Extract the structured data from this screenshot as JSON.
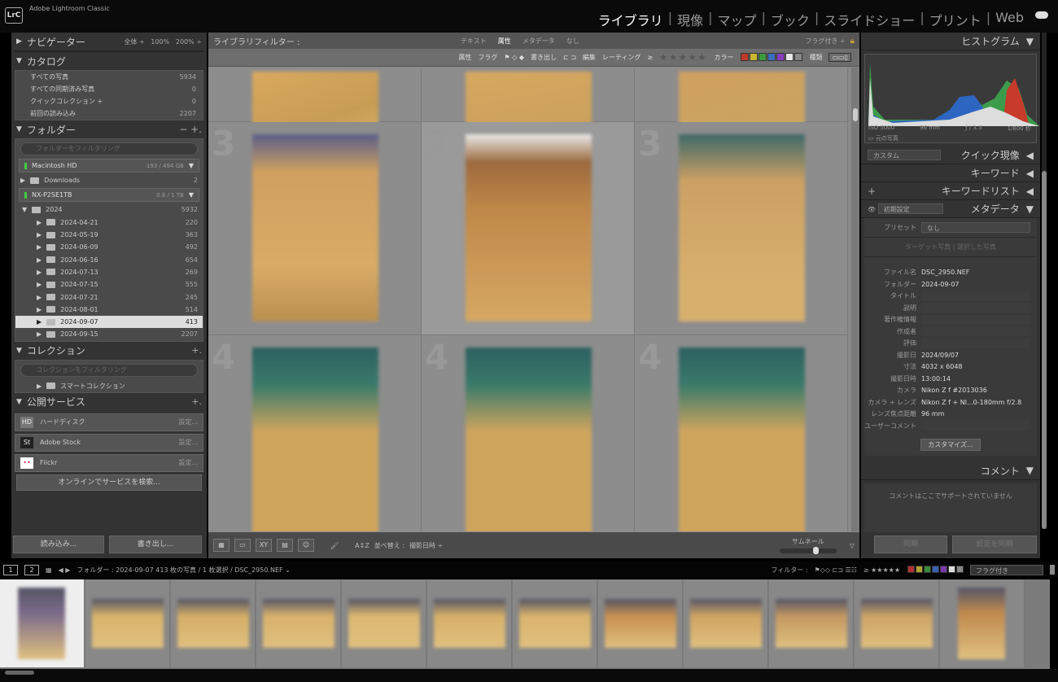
{
  "app": {
    "logo": "LrC",
    "title": "Adobe Lightroom Classic"
  },
  "modules": [
    "ライブラリ",
    "現像",
    "マップ",
    "ブック",
    "スライドショー",
    "プリント",
    "Web"
  ],
  "active_module": "ライブラリ",
  "navigator": {
    "title": "ナビゲーター",
    "options": [
      "全体",
      "100%",
      "200%"
    ]
  },
  "catalog": {
    "title": "カタログ",
    "items": [
      {
        "label": "すべての写真",
        "count": "5934"
      },
      {
        "label": "すべての同期済み写真",
        "count": "0"
      },
      {
        "label": "クイックコレクション +",
        "count": "0"
      },
      {
        "label": "前回の読み込み",
        "count": "2207"
      }
    ]
  },
  "folders": {
    "title": "フォルダー",
    "actions": "−  +.",
    "search_placeholder": "フォルダーをフィルタリング",
    "volume1": {
      "name": "Macintosh HD",
      "size": "193 / 494 GB"
    },
    "vol1_items": [
      {
        "label": "Downloads",
        "count": "2"
      }
    ],
    "volume2": {
      "name": "NX-P2SE1TB",
      "size": "0.8 / 1 TB"
    },
    "root": {
      "label": "2024",
      "count": "5932"
    },
    "items": [
      {
        "label": "2024-04-21",
        "count": "220"
      },
      {
        "label": "2024-05-19",
        "count": "363"
      },
      {
        "label": "2024-06-09",
        "count": "492"
      },
      {
        "label": "2024-06-16",
        "count": "654"
      },
      {
        "label": "2024-07-13",
        "count": "269"
      },
      {
        "label": "2024-07-15",
        "count": "555"
      },
      {
        "label": "2024-07-21",
        "count": "245"
      },
      {
        "label": "2024-08-01",
        "count": "514"
      },
      {
        "label": "2024-09-07",
        "count": "413"
      },
      {
        "label": "2024-09-15",
        "count": "2207"
      }
    ],
    "selected": "2024-09-07"
  },
  "collections": {
    "title": "コレクション",
    "search_placeholder": "コレクションをフィルタリング",
    "items": [
      {
        "label": "スマートコレクション"
      }
    ]
  },
  "publish": {
    "title": "公開サービス",
    "items": [
      {
        "label": "ハードディスク",
        "icon": "HD",
        "action": "設定..."
      },
      {
        "label": "Adobe Stock",
        "icon": "St",
        "action": "設定..."
      },
      {
        "label": "Flickr",
        "icon": "••",
        "action": "設定..."
      }
    ],
    "find": "オンラインでサービスを検索..."
  },
  "left_buttons": {
    "import": "読み込み...",
    "export": "書き出し..."
  },
  "filter": {
    "title": "ライブラリフィルター :",
    "tabs": [
      "テキスト",
      "属性",
      "メタデータ",
      "なし"
    ],
    "active_tab": "属性",
    "preset": "フラグ付き ÷",
    "attr_label": "属性",
    "flag_label": "フラグ",
    "export_label": "書き出し",
    "edit_label": "編集",
    "rating_label": "レーティング",
    "rating_op": "≥",
    "stars": "★★★★★",
    "color_label": "カラー",
    "kind_label": "種類",
    "colors": [
      "#c0392b",
      "#c8b830",
      "#3d9a3d",
      "#3b6fc0",
      "#8a3dbf",
      "#e8e8e8",
      "#888888"
    ]
  },
  "grid": {
    "cell_numbers": [
      "",
      "",
      "",
      "3",
      "3",
      "3",
      "4",
      "4",
      "4"
    ]
  },
  "toolbar": {
    "sort_label": "並べ替え :",
    "sort_value": "撮影日時 ÷",
    "thumb_label": "サムネール",
    "thumb_value": 0.65
  },
  "histogram": {
    "title": "ヒストグラム",
    "iso": "ISO 5000",
    "focal": "96 mm",
    "aperture": "ƒ / 3.5",
    "shutter": "1/800 秒",
    "original": "元の写真"
  },
  "quick_develop": {
    "title": "クイック現像",
    "preset": "カスタム"
  },
  "keywording": {
    "title": "キーワード"
  },
  "keyword_list": {
    "title": "キーワードリスト"
  },
  "metadata": {
    "title": "メタデータ",
    "preset_select": "初期設定",
    "preset_label": "プリセット",
    "preset_value": "なし",
    "target_tabs": [
      "ターゲット写真",
      "選択した写真"
    ],
    "fields": [
      {
        "k": "ファイル名",
        "v": "DSC_2950.NEF"
      },
      {
        "k": "フォルダー",
        "v": "2024-09-07"
      },
      {
        "k": "タイトル",
        "v": ""
      },
      {
        "k": "説明",
        "v": ""
      },
      {
        "k": "著作権情報",
        "v": ""
      },
      {
        "k": "作成者",
        "v": ""
      },
      {
        "k": "評価",
        "v": ""
      },
      {
        "k": "撮影日",
        "v": "2024/09/07"
      },
      {
        "k": "寸法",
        "v": "4032 x 6048"
      },
      {
        "k": "撮影日時",
        "v": "13:00:14"
      },
      {
        "k": "カメラ",
        "v": "Nikon Z f #2013036"
      },
      {
        "k": "カメラ + レンズ",
        "v": "Nikon Z f + NI...0-180mm f/2.8"
      },
      {
        "k": "レンズ焦点距離",
        "v": "96 mm"
      },
      {
        "k": "ユーザーコメント",
        "v": ""
      }
    ],
    "customize": "カスタマイズ..."
  },
  "comments": {
    "title": "コメント",
    "message": "コメントはここでサポートされていません"
  },
  "right_buttons": {
    "sync": "同期",
    "sync_settings": "設定を同期"
  },
  "filmstrip": {
    "monitors": [
      "1",
      "2"
    ],
    "path": "フォルダー : 2024-09-07  413 枚の写真 / 1 枚選択 / DSC_2950.NEF ⌄",
    "filter_label": "フィルター :",
    "stars": "≥ ★★★★★",
    "flag_select": "フラグ付き",
    "colors": [
      "#b03030",
      "#b0a030",
      "#3a8a3a",
      "#3a5fb0",
      "#7a3aaa",
      "#ddd",
      "#888"
    ]
  }
}
